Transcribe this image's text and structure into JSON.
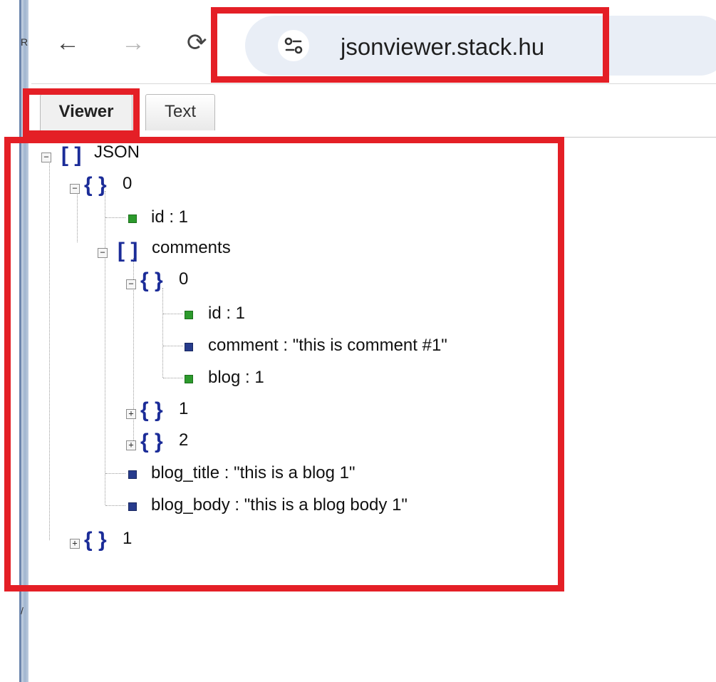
{
  "browser": {
    "back_icon": "arrow-left-icon",
    "forward_icon": "arrow-right-icon",
    "reload_icon": "reload-icon",
    "site_info_icon": "tune-icon",
    "url": "jsonviewer.stack.hu"
  },
  "tabs": [
    {
      "label": "Viewer",
      "active": true
    },
    {
      "label": "Text",
      "active": false
    }
  ],
  "tree": {
    "root_label": "JSON",
    "n0_label": "0",
    "n0_id": "id : 1",
    "n0_comments": "comments",
    "c0_label": "0",
    "c0_id": "id : 1",
    "c0_comment": "comment : \"this is comment #1\"",
    "c0_blog": "blog : 1",
    "c1_label": "1",
    "c2_label": "2",
    "n0_blog_title": "blog_title : \"this is a blog 1\"",
    "n0_blog_body": "blog_body : \"this is a blog body 1\"",
    "n1_label": "1"
  },
  "colors": {
    "highlight": "#e41f26",
    "bracket": "#1b2c98",
    "number_leaf": "#2c9a2c",
    "string_leaf": "#273b8c"
  }
}
